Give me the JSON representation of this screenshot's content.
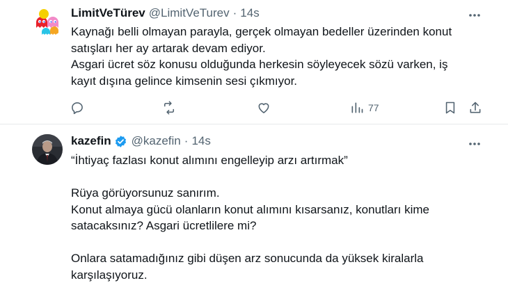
{
  "tweets": [
    {
      "name": "LimitVeTürev",
      "handle": "@LimitVeTurev",
      "separator": "·",
      "time": "14s",
      "verified": false,
      "body_lines": [
        "Kaynağı belli olmayan parayla, gerçek olmayan bedeller üzerinden konut",
        "satışları her ay artarak devam ediyor.",
        "Asgari ücret söz konusu olduğunda herkesin söyleyecek sözü varken, iş",
        "kayıt dışına gelince kimsenin sesi çıkmıyor."
      ],
      "actions": {
        "reply_icon": "reply-icon",
        "retweet_icon": "retweet-icon",
        "like_icon": "heart-icon",
        "views_icon": "views-icon",
        "views_count": "77",
        "bookmark_icon": "bookmark-icon",
        "share_icon": "share-icon"
      }
    },
    {
      "name": "kazefin",
      "handle": "@kazefin",
      "separator": "·",
      "time": "14s",
      "verified": true,
      "body_lines": [
        "“İhtiyaç fazlası konut alımını engelleyip arzı artırmak”",
        "",
        "Rüya görüyorsunuz sanırım.",
        "Konut almaya gücü olanların konut alımını kısarsanız, konutları kime",
        "satacaksınız? Asgari ücretlilere mi?",
        "",
        "Onlara satamadığınız gibi düşen arz sonucunda da yüksek kiralarla",
        "karşılaşıyoruz."
      ]
    }
  ],
  "colors": {
    "text": "#0f1419",
    "secondary": "#536471",
    "verified": "#1d9bf0",
    "divider": "#e6e9eb"
  }
}
